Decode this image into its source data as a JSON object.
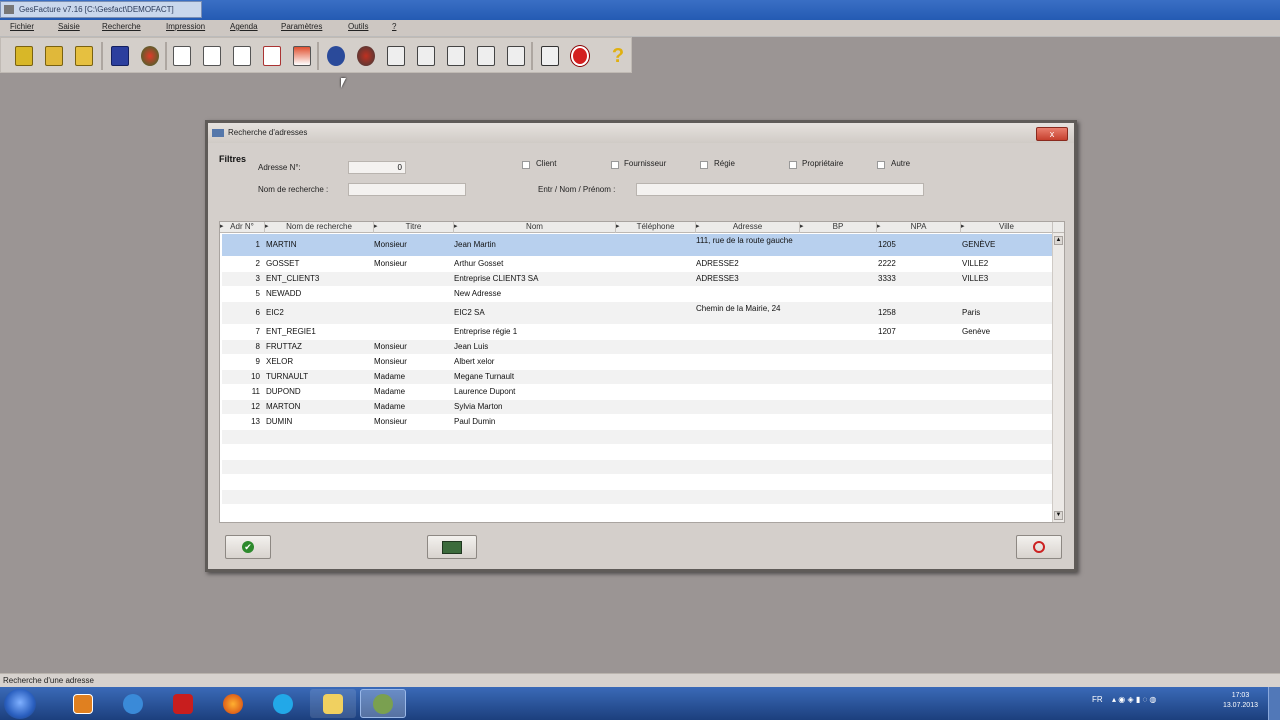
{
  "window": {
    "title": "GesFacture v7.16 [C:\\Gesfact\\DEMOFACT]"
  },
  "menu": [
    "Fichier",
    "Saisie",
    "Recherche",
    "Impression",
    "Agenda",
    "Paramètres",
    "Outils",
    "?"
  ],
  "toolbar": {
    "buttons": [
      "new-folder-icon",
      "open-folder-icon",
      "folder-icon",
      "book-icon",
      "clients-icon",
      "doc-t-icon",
      "doc-l-icon",
      "doc-d-icon",
      "doc-c-icon",
      "doc-f-icon",
      "doc-n-icon",
      "doc-multi-icon",
      "search-user-icon",
      "search-person-icon",
      "search-doc-icon",
      "search-doc2-icon",
      "search-doc3-icon",
      "search-doc4-icon",
      "search-doc5-icon",
      "notes-icon",
      "stop-icon",
      "help-icon"
    ]
  },
  "dialog": {
    "title": "Recherche d'adresses",
    "close_label": "x",
    "filters_label": "Filtres",
    "adresse_no_label": "Adresse N°:",
    "adresse_no_value": "0",
    "nom_recherche_label": "Nom de recherche :",
    "nom_recherche_value": "",
    "entreprise_label": "Entr / Nom / Prénom :",
    "entreprise_value": "",
    "checkboxes": [
      "Client",
      "Fournisseur",
      "Régie",
      "Propriétaire",
      "Autre"
    ],
    "columns": [
      "Adr N°",
      "Nom de recherche",
      "Titre",
      "Nom",
      "Téléphone",
      "Adresse",
      "BP",
      "NPA",
      "Ville"
    ],
    "rows": [
      {
        "no": "1",
        "search": "MARTIN",
        "title": "Monsieur",
        "name": "Jean Martin",
        "phone": "",
        "address": "111, rue de la route gauche",
        "bp": "",
        "npa": "1205",
        "city": "GENÈVE"
      },
      {
        "no": "2",
        "search": "GOSSET",
        "title": "Monsieur",
        "name": "Arthur Gosset",
        "phone": "",
        "address": "ADRESSE2",
        "bp": "",
        "npa": "2222",
        "city": "VILLE2"
      },
      {
        "no": "3",
        "search": "ENT_CLIENT3",
        "title": "",
        "name": "Entreprise CLIENT3 SA",
        "phone": "",
        "address": "ADRESSE3",
        "bp": "",
        "npa": "3333",
        "city": "VILLE3"
      },
      {
        "no": "5",
        "search": "NEWADD",
        "title": "",
        "name": "New Adresse",
        "phone": "",
        "address": "",
        "bp": "",
        "npa": "",
        "city": ""
      },
      {
        "no": "6",
        "search": "EIC2",
        "title": "",
        "name": "EIC2 SA",
        "phone": "",
        "address": "Chemin de la Mairie, 24",
        "bp": "",
        "npa": "1258",
        "city": "Paris"
      },
      {
        "no": "7",
        "search": "ENT_REGIE1",
        "title": "",
        "name": "Entreprise régie 1",
        "phone": "",
        "address": "",
        "bp": "",
        "npa": "1207",
        "city": "Genève"
      },
      {
        "no": "8",
        "search": "FRUTTAZ",
        "title": "Monsieur",
        "name": "Jean Luis",
        "phone": "",
        "address": "",
        "bp": "",
        "npa": "",
        "city": ""
      },
      {
        "no": "9",
        "search": "XELOR",
        "title": "Monsieur",
        "name": "Albert xelor",
        "phone": "",
        "address": "",
        "bp": "",
        "npa": "",
        "city": ""
      },
      {
        "no": "10",
        "search": "TURNAULT",
        "title": "Madame",
        "name": "Megane Turnault",
        "phone": "",
        "address": "",
        "bp": "",
        "npa": "",
        "city": ""
      },
      {
        "no": "11",
        "search": "DUPOND",
        "title": "Madame",
        "name": "Laurence Dupont",
        "phone": "",
        "address": "",
        "bp": "",
        "npa": "",
        "city": ""
      },
      {
        "no": "12",
        "search": "MARTON",
        "title": "Madame",
        "name": "Sylvia Marton",
        "phone": "",
        "address": "",
        "bp": "",
        "npa": "",
        "city": ""
      },
      {
        "no": "13",
        "search": "DUMIN",
        "title": "Monsieur",
        "name": "Paul Dumin",
        "phone": "",
        "address": "",
        "bp": "",
        "npa": "",
        "city": ""
      }
    ],
    "selected_row": 0,
    "ok_icon": "check-icon",
    "new_icon": "new-record-icon",
    "cancel_icon": "cancel-icon"
  },
  "status": {
    "text": "Recherche d'une adresse"
  },
  "taskbar": {
    "apps": [
      "media-player-icon",
      "ie-icon",
      "pdf-icon",
      "firefox-icon",
      "skype-icon",
      "explorer-icon",
      "gesfacture-icon"
    ],
    "lang": "FR",
    "time": "17:03",
    "date": "13.07.2013"
  },
  "colors": {
    "selection": "#b8d0ee",
    "title_blue": "#245bb3",
    "taskbar": "#1c3f7d"
  }
}
